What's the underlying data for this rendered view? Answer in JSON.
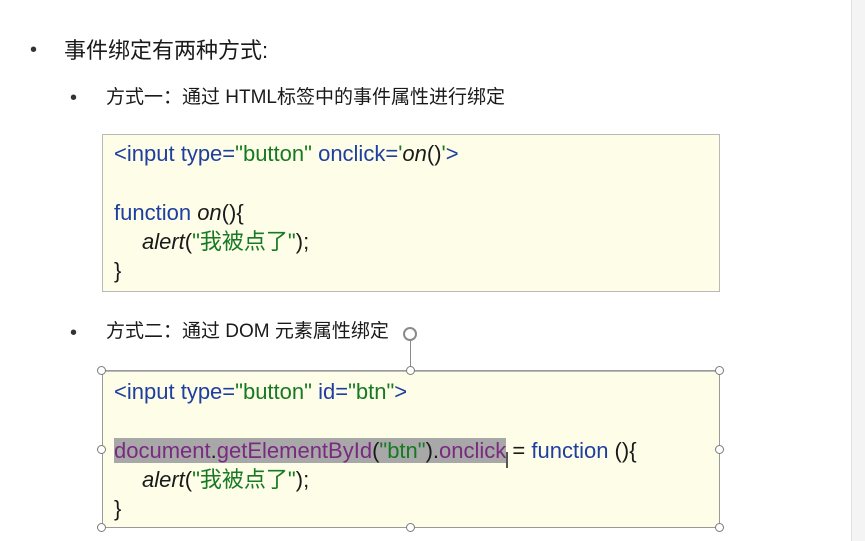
{
  "slide": {
    "heading": "事件绑定有两种方式:",
    "method1": {
      "title": "方式一：通过 HTML标签中的事件属性进行绑定",
      "code": {
        "l1": {
          "lt": "<",
          "tag": "input",
          "sp1": " ",
          "attr1": "type",
          "eq1": "=",
          "val1": "\"button\"",
          "sp2": " ",
          "attr2": "onclick",
          "eq2": "=",
          "q1": "'",
          "fn": "on",
          "parens": "()",
          "q2": "'",
          "gt": ">"
        },
        "l2": {
          "kw": "function",
          "sp": " ",
          "fn": "on",
          "rest": "(){"
        },
        "l3": {
          "fn": "alert",
          "open": "(",
          "str": "\"我被点了\"",
          "close": ");"
        },
        "l4": "}"
      }
    },
    "method2": {
      "title": "方式二：通过 DOM 元素属性绑定",
      "code": {
        "l1": {
          "lt": "<",
          "tag": "input",
          "sp1": " ",
          "attr1": "type",
          "eq1": "=",
          "val1": "\"button\"",
          "sp2": " ",
          "attr2": "id",
          "eq2": "=",
          "val2": "\"btn\"",
          "gt": ">"
        },
        "l2": {
          "obj": "document",
          "dot1": ".",
          "method": "getElementById",
          "open": "(",
          "arg": "\"btn\"",
          "close": ")",
          "dot2": ".",
          "prop": "onclick",
          "assign": " = ",
          "kw": "function",
          "rest": " (){"
        },
        "l3": {
          "fn": "alert",
          "open": "(",
          "str": "\"我被点了\"",
          "close": ");"
        },
        "l4": "}"
      }
    },
    "bullet_glyph": "•"
  }
}
